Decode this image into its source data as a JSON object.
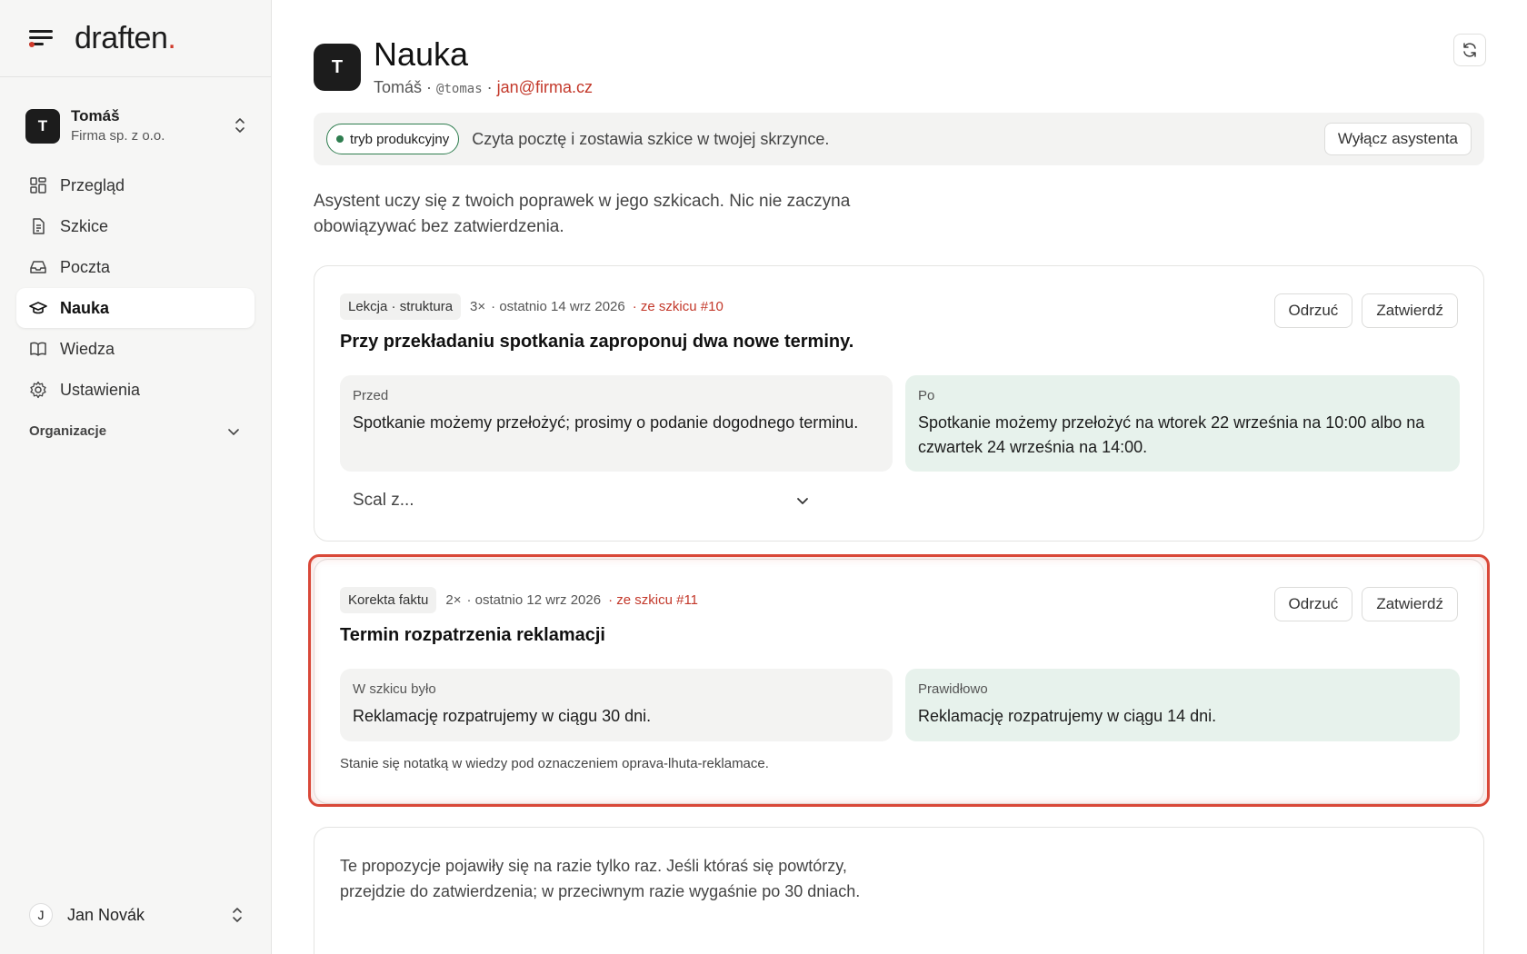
{
  "brand": {
    "logo": "draften",
    "logo_dot": "."
  },
  "account": {
    "initial": "T",
    "name": "Tomáš",
    "org": "Firma sp. z o.o."
  },
  "nav": [
    {
      "label": "Przegląd",
      "icon": "grid-icon",
      "active": false
    },
    {
      "label": "Szkice",
      "icon": "document-icon",
      "active": false
    },
    {
      "label": "Poczta",
      "icon": "inbox-icon",
      "active": false
    },
    {
      "label": "Nauka",
      "icon": "graduation-cap-icon",
      "active": true
    },
    {
      "label": "Wiedza",
      "icon": "book-icon",
      "active": false
    },
    {
      "label": "Ustawienia",
      "icon": "gear-icon",
      "active": false
    }
  ],
  "orgs_label": "Organizacje",
  "user": {
    "initial": "J",
    "name": "Jan Novák"
  },
  "header": {
    "initial": "T",
    "title": "Nauka",
    "owner": "Tomáš",
    "separator": "·",
    "handle": "@tomas",
    "email": "jan@firma.cz"
  },
  "mode": {
    "badge": "tryb produkcyjny",
    "text": "Czyta pocztę i zostawia szkice w twojej skrzynce.",
    "disable_label": "Wyłącz asystenta",
    "status_color": "#2e7d4f"
  },
  "intro": "Asystent uczy się z twoich poprawek w jego szkicach. Nic nie zaczyna obowiązywać bez zatwierdzenia.",
  "cards": [
    {
      "tag": "Lekcja · struktura",
      "count": "3×",
      "last": "· ostatnio 14 wrz 2026",
      "source": "· ze szkicu #10",
      "reject_label": "Odrzuć",
      "approve_label": "Zatwierdź",
      "title": "Przy przekładaniu spotkania zaproponuj dwa nowe terminy.",
      "before_label": "Przed",
      "before_text": "Spotkanie możemy przełożyć; prosimy o podanie dogodnego terminu.",
      "after_label": "Po",
      "after_text": "Spotkanie możemy przełożyć na wtorek 22 września na 10:00 albo na czwartek 24 września na 14:00.",
      "merge_label": "Scal z..."
    },
    {
      "tag": "Korekta faktu",
      "count": "2×",
      "last": "· ostatnio 12 wrz 2026",
      "source": "· ze szkicu #11",
      "reject_label": "Odrzuć",
      "approve_label": "Zatwierdź",
      "title": "Termin rozpatrzenia reklamacji",
      "before_label": "W szkicu było",
      "before_text": "Reklamację rozpatrujemy w ciągu 30 dni.",
      "after_label": "Prawidłowo",
      "after_text": "Reklamację rozpatrujemy w ciągu 14 dni.",
      "note": "Stanie się notatką w wiedzy pod oznaczeniem oprava-lhuta-reklamace."
    }
  ],
  "info": "Te propozycje pojawiły się na razie tylko raz. Jeśli któraś się powtórzy, przejdzie do zatwierdzenia; w przeciwnym razie wygaśnie po 30 dniach.",
  "colors": {
    "accent": "#d03a2b",
    "after_bg": "#e7f2ec",
    "highlight": "#d94838"
  }
}
